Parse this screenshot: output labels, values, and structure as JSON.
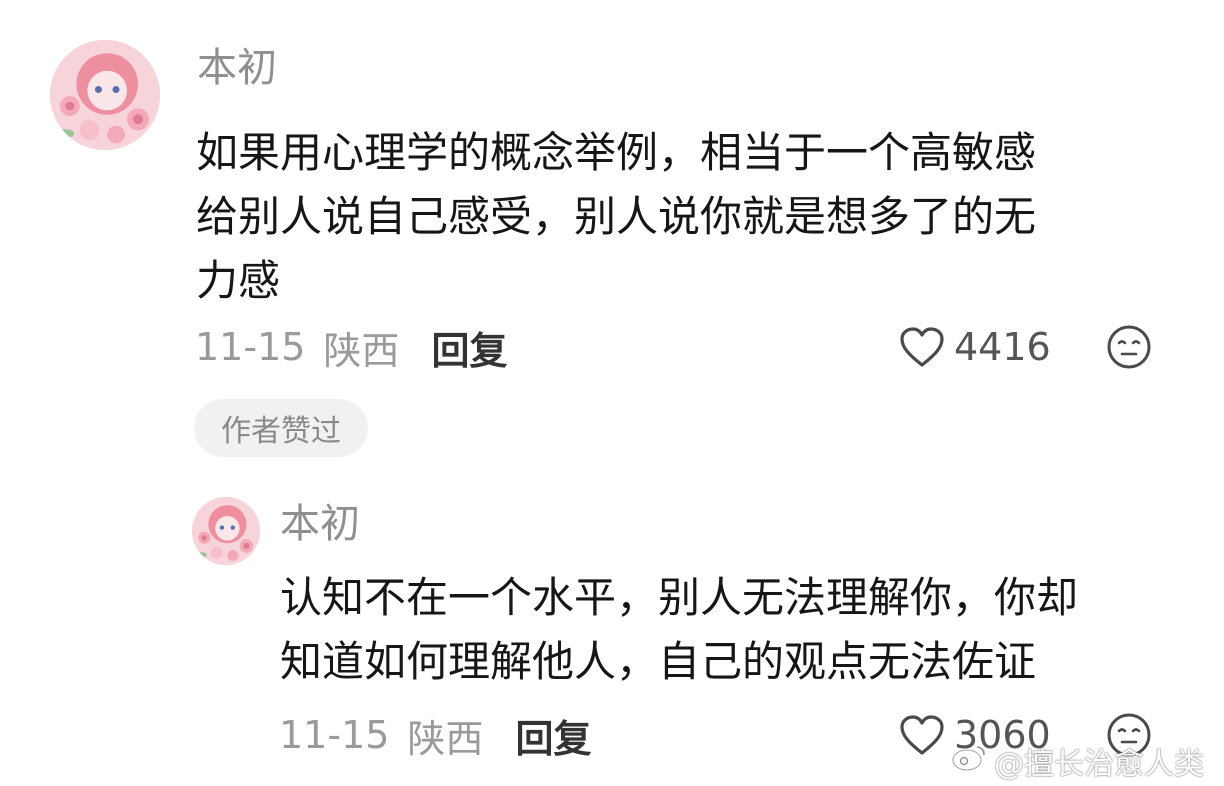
{
  "comments": [
    {
      "username": "本初",
      "content_lines": [
        "如果用心理学的概念举例，相当于一个高敏感",
        "给别人说自己感受，别人说你就是想多了的无",
        "力感"
      ],
      "date": "11-15",
      "location": "陕西",
      "reply_label": "回复",
      "like_count": "4416",
      "badge": "作者赞过"
    },
    {
      "username": "本初",
      "content_lines": [
        "认知不在一个水平，别人无法理解你，你却",
        "知道如何理解他人，自己的观点无法佐证"
      ],
      "date": "11-15",
      "location": "陕西",
      "reply_label": "回复",
      "like_count": "3060"
    }
  ],
  "watermark": {
    "text": "@擅长治愈人类"
  },
  "icons": {
    "like": "heart-outline-icon",
    "emoji": "neutral-face-emoji-icon",
    "watermark": "weibo-logo-icon"
  },
  "colors": {
    "text": "#161616",
    "muted": "#9a9a9a",
    "badge_bg": "#f1f1f1",
    "avatar_pink": "#f6cfd6"
  }
}
